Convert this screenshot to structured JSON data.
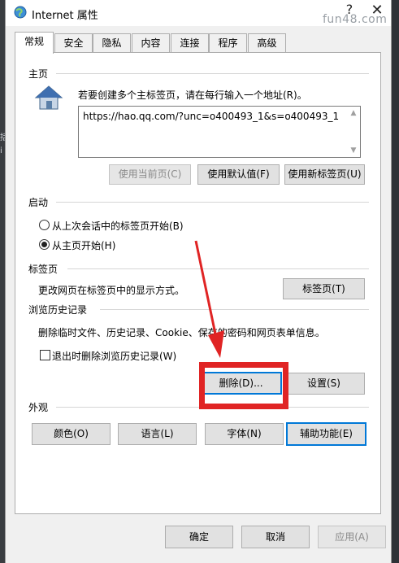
{
  "window": {
    "title": "Internet 属性",
    "watermark": "fun48.com",
    "help": "?",
    "close": "✕"
  },
  "left_strip": [
    "括",
    "i"
  ],
  "tabs": [
    "常规",
    "安全",
    "隐私",
    "内容",
    "连接",
    "程序",
    "高级"
  ],
  "homepage": {
    "section": "主页",
    "instruction": "若要创建多个主标签页，请在每行输入一个地址(R)。",
    "url": "https://hao.qq.com/?unc=o400493_1&s=o400493_1",
    "buttons": {
      "current": "使用当前页(C)",
      "default": "使用默认值(F)",
      "newtab": "使用新标签页(U)"
    }
  },
  "startup": {
    "section": "启动",
    "option1": "从上次会话中的标签页开始(B)",
    "option2": "从主页开始(H)",
    "selected": "option2"
  },
  "tabs_section": {
    "section": "标签页",
    "text": "更改网页在标签页中的显示方式。",
    "button": "标签页(T)"
  },
  "history": {
    "section": "浏览历史记录",
    "text": "删除临时文件、历史记录、Cookie、保存的密码和网页表单信息。",
    "checkbox": "退出时删除浏览历史记录(W)",
    "delete_button": "删除(D)...",
    "settings_button": "设置(S)"
  },
  "appearance": {
    "section": "外观",
    "buttons": {
      "colors": "颜色(O)",
      "languages": "语言(L)",
      "fonts": "字体(N)",
      "accessibility": "辅助功能(E)"
    }
  },
  "footer": {
    "ok": "确定",
    "cancel": "取消",
    "apply": "应用(A)"
  },
  "colors": {
    "annotation": "#e02424",
    "focus": "#0078d7"
  }
}
